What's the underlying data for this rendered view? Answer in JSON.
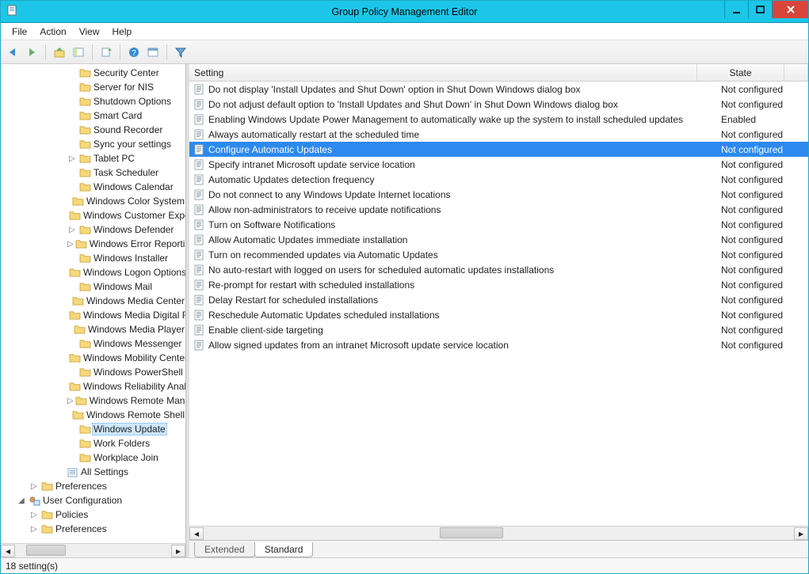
{
  "window": {
    "title": "Group Policy Management Editor"
  },
  "menu": [
    "File",
    "Action",
    "View",
    "Help"
  ],
  "toolbar_icons": [
    "back",
    "forward",
    "up",
    "show-hide-tree",
    "export-list",
    "help",
    "properties",
    "filter"
  ],
  "tree": {
    "items": [
      {
        "depth": 5,
        "exp": "",
        "icon": "folder",
        "label": "Security Center"
      },
      {
        "depth": 5,
        "exp": "",
        "icon": "folder",
        "label": "Server for NIS"
      },
      {
        "depth": 5,
        "exp": "",
        "icon": "folder",
        "label": "Shutdown Options"
      },
      {
        "depth": 5,
        "exp": "",
        "icon": "folder",
        "label": "Smart Card"
      },
      {
        "depth": 5,
        "exp": "",
        "icon": "folder",
        "label": "Sound Recorder"
      },
      {
        "depth": 5,
        "exp": "",
        "icon": "folder",
        "label": "Sync your settings"
      },
      {
        "depth": 5,
        "exp": "▷",
        "icon": "folder",
        "label": "Tablet PC"
      },
      {
        "depth": 5,
        "exp": "",
        "icon": "folder",
        "label": "Task Scheduler"
      },
      {
        "depth": 5,
        "exp": "",
        "icon": "folder",
        "label": "Windows Calendar"
      },
      {
        "depth": 5,
        "exp": "",
        "icon": "folder",
        "label": "Windows Color System"
      },
      {
        "depth": 5,
        "exp": "",
        "icon": "folder",
        "label": "Windows Customer Experience Improvement Program"
      },
      {
        "depth": 5,
        "exp": "▷",
        "icon": "folder",
        "label": "Windows Defender"
      },
      {
        "depth": 5,
        "exp": "▷",
        "icon": "folder",
        "label": "Windows Error Reporting"
      },
      {
        "depth": 5,
        "exp": "",
        "icon": "folder",
        "label": "Windows Installer"
      },
      {
        "depth": 5,
        "exp": "",
        "icon": "folder",
        "label": "Windows Logon Options"
      },
      {
        "depth": 5,
        "exp": "",
        "icon": "folder",
        "label": "Windows Mail"
      },
      {
        "depth": 5,
        "exp": "",
        "icon": "folder",
        "label": "Windows Media Center"
      },
      {
        "depth": 5,
        "exp": "",
        "icon": "folder",
        "label": "Windows Media Digital Rights Management"
      },
      {
        "depth": 5,
        "exp": "",
        "icon": "folder",
        "label": "Windows Media Player"
      },
      {
        "depth": 5,
        "exp": "",
        "icon": "folder",
        "label": "Windows Messenger"
      },
      {
        "depth": 5,
        "exp": "",
        "icon": "folder",
        "label": "Windows Mobility Center"
      },
      {
        "depth": 5,
        "exp": "",
        "icon": "folder",
        "label": "Windows PowerShell"
      },
      {
        "depth": 5,
        "exp": "",
        "icon": "folder",
        "label": "Windows Reliability Analysis"
      },
      {
        "depth": 5,
        "exp": "▷",
        "icon": "folder",
        "label": "Windows Remote Management (WinRM)"
      },
      {
        "depth": 5,
        "exp": "",
        "icon": "folder",
        "label": "Windows Remote Shell"
      },
      {
        "depth": 5,
        "exp": "",
        "icon": "folder",
        "label": "Windows Update",
        "selected": true
      },
      {
        "depth": 5,
        "exp": "",
        "icon": "folder",
        "label": "Work Folders"
      },
      {
        "depth": 5,
        "exp": "",
        "icon": "folder",
        "label": "Workplace Join"
      },
      {
        "depth": 4,
        "exp": "",
        "icon": "allsettings",
        "label": "All Settings"
      },
      {
        "depth": 2,
        "exp": "▷",
        "icon": "folder",
        "label": "Preferences"
      },
      {
        "depth": 1,
        "exp": "◢",
        "icon": "userconfig",
        "label": "User Configuration"
      },
      {
        "depth": 2,
        "exp": "▷",
        "icon": "folder",
        "label": "Policies"
      },
      {
        "depth": 2,
        "exp": "▷",
        "icon": "folder",
        "label": "Preferences"
      }
    ]
  },
  "list": {
    "columns": {
      "setting": "Setting",
      "state": "State"
    },
    "rows": [
      {
        "name": "Do not display 'Install Updates and Shut Down' option in Shut Down Windows dialog box",
        "state": "Not configured"
      },
      {
        "name": "Do not adjust default option to 'Install Updates and Shut Down' in Shut Down Windows dialog box",
        "state": "Not configured"
      },
      {
        "name": "Enabling Windows Update Power Management to automatically wake up the system to install scheduled updates",
        "state": "Enabled"
      },
      {
        "name": "Always automatically restart at the scheduled time",
        "state": "Not configured"
      },
      {
        "name": "Configure Automatic Updates",
        "state": "Not configured",
        "selected": true
      },
      {
        "name": "Specify intranet Microsoft update service location",
        "state": "Not configured"
      },
      {
        "name": "Automatic Updates detection frequency",
        "state": "Not configured"
      },
      {
        "name": "Do not connect to any Windows Update Internet locations",
        "state": "Not configured"
      },
      {
        "name": "Allow non-administrators to receive update notifications",
        "state": "Not configured"
      },
      {
        "name": "Turn on Software Notifications",
        "state": "Not configured"
      },
      {
        "name": "Allow Automatic Updates immediate installation",
        "state": "Not configured"
      },
      {
        "name": "Turn on recommended updates via Automatic Updates",
        "state": "Not configured"
      },
      {
        "name": "No auto-restart with logged on users for scheduled automatic updates installations",
        "state": "Not configured"
      },
      {
        "name": "Re-prompt for restart with scheduled installations",
        "state": "Not configured"
      },
      {
        "name": "Delay Restart for scheduled installations",
        "state": "Not configured"
      },
      {
        "name": "Reschedule Automatic Updates scheduled installations",
        "state": "Not configured"
      },
      {
        "name": "Enable client-side targeting",
        "state": "Not configured"
      },
      {
        "name": "Allow signed updates from an intranet Microsoft update service location",
        "state": "Not configured"
      }
    ]
  },
  "tabs": {
    "extended": "Extended",
    "standard": "Standard"
  },
  "status": "18 setting(s)"
}
